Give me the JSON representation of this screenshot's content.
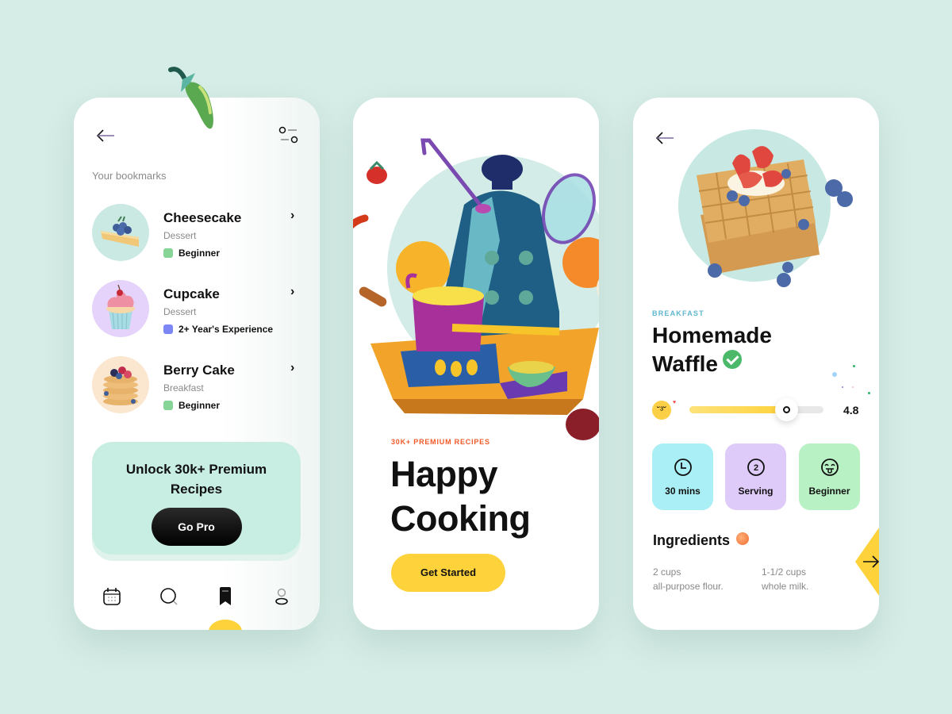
{
  "bookmarks_screen": {
    "section_label": "Your bookmarks",
    "items": [
      {
        "name": "Cheesecake",
        "category": "Dessert",
        "level": "Beginner",
        "level_color": "#86d496",
        "thumb_bg": "#cbe9e3",
        "thumb_icon": "cheesecake"
      },
      {
        "name": "Cupcake",
        "category": "Dessert",
        "level": "2+ Year's Experience",
        "level_color": "#7d86f5",
        "thumb_bg": "#e5d3fb",
        "thumb_icon": "cupcake"
      },
      {
        "name": "Berry Cake",
        "category": "Breakfast",
        "level": "Beginner",
        "level_color": "#86d496",
        "thumb_bg": "#fbe6cf",
        "thumb_icon": "pancakes"
      }
    ],
    "promo": {
      "title": "Unlock 30k+ Premium Recipes",
      "button": "Go Pro"
    },
    "nav": [
      {
        "icon": "calendar-icon",
        "label": "Calendar"
      },
      {
        "icon": "search-icon",
        "label": "Search"
      },
      {
        "icon": "bookmark-icon",
        "label": "Bookmarks",
        "active": true
      },
      {
        "icon": "profile-icon",
        "label": "Profile"
      }
    ]
  },
  "welcome_screen": {
    "kicker": "30K+ PREMIUM RECIPES",
    "title_line1": "Happy",
    "title_line2": "Cooking",
    "cta": "Get Started"
  },
  "recipe_screen": {
    "category": "BREAKFAST",
    "title_line1": "Homemade",
    "title_line2": "Waffle",
    "verified": true,
    "rating": {
      "value": "4.8",
      "fraction": 0.72
    },
    "stats": [
      {
        "icon": "clock-icon",
        "label": "30 mins",
        "bg": "#a9eff5"
      },
      {
        "icon": "serving-icon",
        "value": "2",
        "label": "Serving",
        "bg": "#dfcbfa"
      },
      {
        "icon": "tongue-face-icon",
        "label": "Beginner",
        "bg": "#b8f2c4"
      }
    ],
    "ingredients_title": "Ingredients",
    "ingredients": [
      {
        "qty": "2 cups",
        "item": "all-purpose flour."
      },
      {
        "qty": "1-1/2 cups",
        "item": "whole milk."
      }
    ]
  },
  "colors": {
    "background": "#d6ece6",
    "accent_yellow": "#fdd23a",
    "kicker_orange": "#f05a28",
    "category_blue": "#5fb7cf",
    "verified_green": "#4cb96a"
  }
}
